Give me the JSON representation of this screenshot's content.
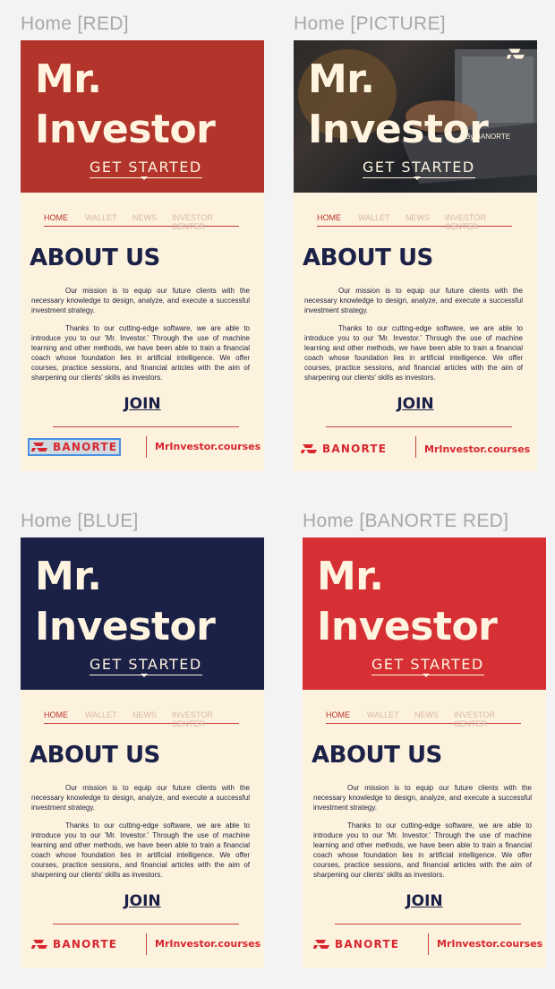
{
  "frames": [
    {
      "label": "Home [RED]",
      "theme": "red",
      "hero_color": "#b2342b"
    },
    {
      "label": "Home [PICTURE]",
      "theme": "picture",
      "hero_color": "#2a2826"
    },
    {
      "label": "Home [BLUE]",
      "theme": "blue",
      "hero_color": "#1a2046"
    },
    {
      "label": "Home [BANORTE RED]",
      "theme": "banorte-red",
      "hero_color": "#d63034"
    }
  ],
  "hero": {
    "title_line1": "Mr.",
    "title_line2": "Investor",
    "cta": "GET STARTED",
    "by": "By BANORTE"
  },
  "nav": {
    "home": "HOME",
    "wallet": "WALLET",
    "news": "NEWS",
    "investor_center": "INVESTOR CENTER"
  },
  "about": {
    "heading": "ABOUT US",
    "paragraph1": "Our mission is to equip our future clients with the necessary knowledge to design, analyze, and execute a successful investment strategy.",
    "paragraph2": "Thanks to our cutting-edge software, we are able to introduce you to our 'Mr. Investor.' Through the use of machine learning and other methods, we have been able to train a financial coach whose foundation lies in artificial intelligence. We offer courses, practice sessions, and financial articles with the aim of sharpening our clients' skills as investors."
  },
  "join": "JOIN",
  "footer": {
    "brand": "BANORTE",
    "site": "MrInvestor.courses"
  },
  "colors": {
    "cream": "#fdf2de",
    "navy": "#1b2147",
    "accent_red": "#d8262e",
    "label_gray": "#a8a8a8"
  }
}
